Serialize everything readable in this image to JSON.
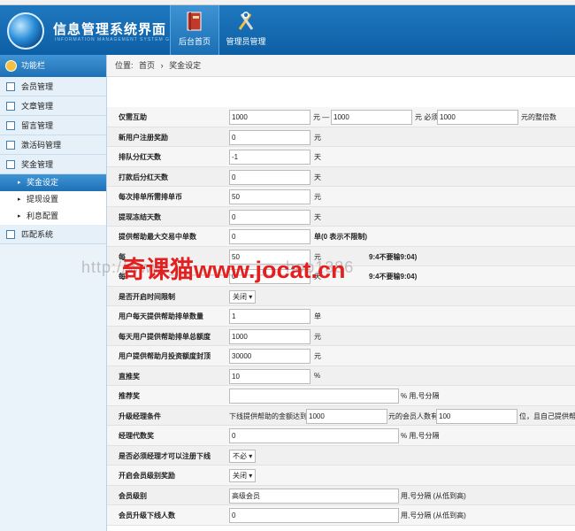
{
  "header": {
    "title": "信息管理系统界面",
    "subtitle": "INFORMATION MANAGEMENT SYSTEM GUI",
    "nav": [
      {
        "label": "后台首页",
        "icon": "book-icon",
        "active": true
      },
      {
        "label": "管理员管理",
        "icon": "tools-icon",
        "active": false
      }
    ]
  },
  "sidebar": {
    "heading": "功能栏",
    "items": [
      {
        "label": "会员管理",
        "icon": "list-icon"
      },
      {
        "label": "文章管理",
        "icon": "edit-icon"
      },
      {
        "label": "留言管理",
        "icon": "list-icon"
      },
      {
        "label": "激活码管理",
        "icon": "list-icon"
      },
      {
        "label": "奖金管理",
        "icon": "list-icon"
      }
    ],
    "sub_items": [
      {
        "label": "奖金设定",
        "active": true
      },
      {
        "label": "提现设置",
        "active": false
      },
      {
        "label": "利息配置",
        "active": false
      }
    ],
    "last_item": {
      "label": "匹配系统",
      "icon": "list-icon"
    }
  },
  "breadcrumb": {
    "prefix": "位置:",
    "home": "首页",
    "sep": "›",
    "current": "奖金设定"
  },
  "form": {
    "r1": {
      "label": "仅需互助",
      "v1": "1000",
      "t1": "元 —",
      "v2": "1000",
      "t2": "元 必须",
      "v3": "1000",
      "t3": "元的整倍数"
    },
    "r2": {
      "label": "新用户注册奖励",
      "v1": "0",
      "t1": "元"
    },
    "r3": {
      "label": "排队分红天数",
      "v1": "-1",
      "t1": "天"
    },
    "r4": {
      "label": "打款后分红天数",
      "v1": "0",
      "t1": "天"
    },
    "r5": {
      "label": "每次排单所需排单币",
      "v1": "50",
      "t1": "元"
    },
    "r6": {
      "label": "提现冻结天数",
      "v1": "0",
      "t1": "天"
    },
    "r7": {
      "label": "提供帮助最大交易中单数",
      "v1": "0",
      "t1": "单(0 表示不限制)"
    },
    "r8": {
      "label": "每",
      "v1": "50",
      "t1": "元",
      "t2": "9:4不要输9:04)"
    },
    "r9": {
      "label": "每",
      "v1": "0",
      "t1": "天",
      "t2": "9:4不要输9:04)"
    },
    "r10": {
      "label": "是否开启时间限制",
      "sel": "关闭"
    },
    "r11": {
      "label": "用户每天提供帮助排单数量",
      "v1": "1",
      "t1": "单"
    },
    "r12": {
      "label": "每天用户提供帮助排单总额度",
      "v1": "1000",
      "t1": "元"
    },
    "r13": {
      "label": "用户提供帮助月投资额度封顶",
      "v1": "30000",
      "t1": "元"
    },
    "r14": {
      "label": "直推奖",
      "v1": "10",
      "t1": "%"
    },
    "r15": {
      "label": "推荐奖",
      "v1": "",
      "t1": "% 用,号分隔"
    },
    "r16": {
      "label": "升级经理条件",
      "t0": "下线提供帮助的金额达到",
      "v1": "1000",
      "t1": "元的会员人数有",
      "v2": "100",
      "t2": "位，且自己提供帮"
    },
    "r17": {
      "label": "经理代数奖",
      "v1": "0",
      "t1": "% 用,号分隔"
    },
    "r18": {
      "label": "是否必须经理才可以注册下线",
      "sel": "不必"
    },
    "r19": {
      "label": "开启会员级别奖励",
      "sel": "关闭"
    },
    "r20": {
      "label": "会员级别",
      "v1": "高级会员",
      "t1": "用,号分隔 (从低到高)"
    },
    "r21": {
      "label": "会员升级下线人数",
      "v1": "0",
      "t1": "用,号分隔 (从低到高)"
    }
  },
  "watermark": {
    "main": "奇课猫www.jocat.cn",
    "faint": "http://www.____________hop1386"
  }
}
